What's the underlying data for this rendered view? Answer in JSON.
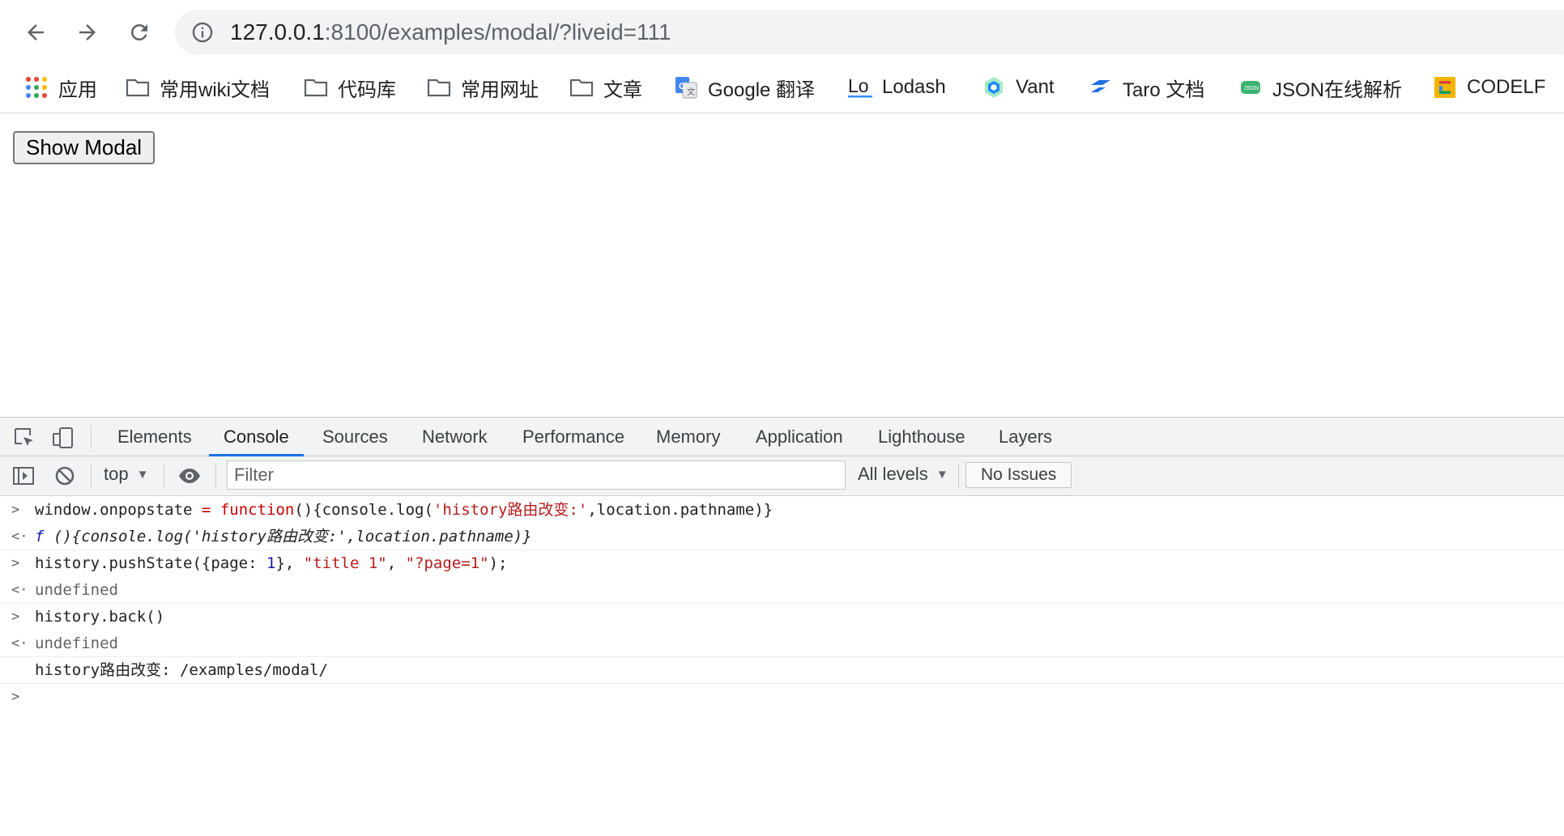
{
  "browser": {
    "url_host": "127.0.0.1",
    "url_rest": ":8100/examples/modal/?liveid=111",
    "bookmarks": [
      {
        "label": "应用",
        "icon": "apps-grid-icon"
      },
      {
        "label": "常用wiki文档",
        "icon": "folder-icon"
      },
      {
        "label": "代码库",
        "icon": "folder-icon"
      },
      {
        "label": "常用网址",
        "icon": "folder-icon"
      },
      {
        "label": "文章",
        "icon": "folder-icon"
      },
      {
        "label": "Google 翻译",
        "icon": "google-translate-icon"
      },
      {
        "label": "Lodash",
        "icon": "lodash-icon"
      },
      {
        "label": "Vant",
        "icon": "vant-icon"
      },
      {
        "label": "Taro 文档",
        "icon": "taro-icon"
      },
      {
        "label": "JSON在线解析",
        "icon": "json-icon"
      },
      {
        "label": "CODELF",
        "icon": "codelf-icon"
      }
    ]
  },
  "page": {
    "show_modal_label": "Show Modal"
  },
  "devtools": {
    "tabs": [
      "Elements",
      "Console",
      "Sources",
      "Network",
      "Performance",
      "Memory",
      "Application",
      "Lighthouse",
      "Layers"
    ],
    "active_tab": "Console",
    "context": "top",
    "filter_placeholder": "Filter",
    "levels": "All levels",
    "issues": "No Issues",
    "console": {
      "l1": {
        "a": "window.onpopstate ",
        "b": "=",
        "c": " ",
        "d": "function",
        "e": "(){console.log(",
        "f": "'history路由改变:'",
        "g": ",location.pathname)}"
      },
      "l2": {
        "a": "f ",
        "b": "(){console.log('history路由改变:',location.pathname)}"
      },
      "l3": {
        "a": "history.pushState({page: ",
        "b": "1",
        "c": "}, ",
        "d": "\"title 1\"",
        "e": ", ",
        "f": "\"?page=1\"",
        "g": ");"
      },
      "l4": "undefined",
      "l5": "history.back()",
      "l6": "undefined",
      "l7": "history路由改变: /examples/modal/"
    }
  },
  "colors": {
    "accent": "#1a73e8",
    "string_red": "#b71c1c",
    "number_blue": "#1a1aa6"
  }
}
